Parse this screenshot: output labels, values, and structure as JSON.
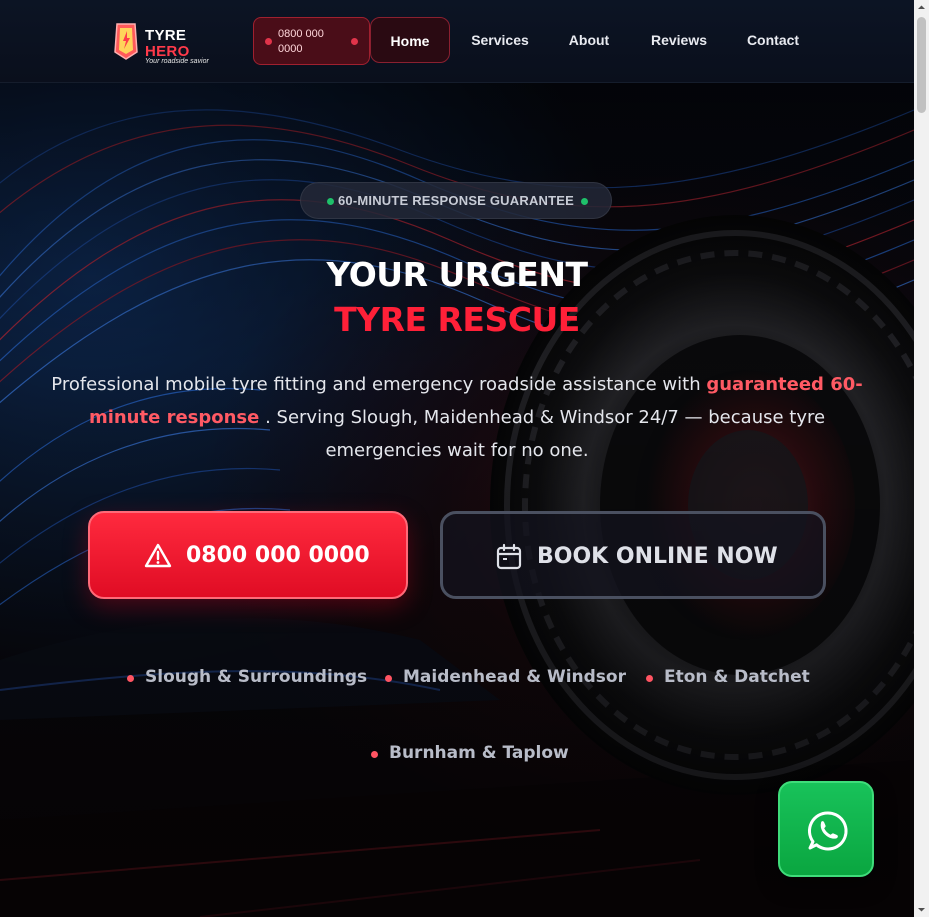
{
  "header": {
    "logo": {
      "word1": "TYRE",
      "word2": "HERO",
      "tagline": "Your roadside savior"
    },
    "phone_label": "0800 000 0000",
    "nav": [
      {
        "label": "Home",
        "active": true
      },
      {
        "label": "Services",
        "active": false
      },
      {
        "label": "About",
        "active": false
      },
      {
        "label": "Reviews",
        "active": false
      },
      {
        "label": "Contact",
        "active": false
      }
    ]
  },
  "hero": {
    "badge": "60-MINUTE RESPONSE GUARANTEE",
    "headline_line1": "YOUR URGENT",
    "headline_line2": "TYRE RESCUE",
    "lead_part1": "Professional mobile tyre fitting and emergency roadside assistance with ",
    "lead_highlight": "guaranteed 60-minute response",
    "lead_part2": " . Serving Slough, Maidenhead & Windsor 24/7 — because tyre emergencies wait for no one.",
    "call_button": {
      "label": "0800 000 0000",
      "icon": "alert-triangle-icon"
    },
    "book_button": {
      "label": "BOOK ONLINE NOW",
      "icon": "calendar-icon"
    },
    "areas": [
      "Slough & Surroundings",
      "Maidenhead & Windsor",
      "Eton & Datchet",
      "Burnham & Taplow"
    ]
  },
  "floating": {
    "whatsapp_icon": "whatsapp-icon"
  },
  "colors": {
    "accent_red": "#ff2038",
    "highlight_red": "#ff5a64",
    "whatsapp_green": "#18c25a",
    "status_green": "#1fc06a",
    "background": "#05070d"
  }
}
